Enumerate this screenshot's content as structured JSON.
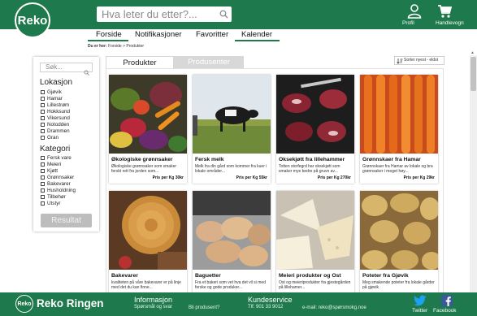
{
  "header": {
    "logo_text": "Reko",
    "search_placeholder": "Hva leter du etter?...",
    "profile_label": "Profil",
    "cart_label": "Handlevogn"
  },
  "nav": {
    "items": [
      "Forside",
      "Notifikasjoner",
      "Favoritter",
      "Kalender"
    ]
  },
  "breadcrumb": {
    "prefix": "Du er her:",
    "path": "Forside > Produkter"
  },
  "sidebar": {
    "search_placeholder": "Søk...",
    "location_heading": "Lokasjon",
    "locations": [
      "Gjøvik",
      "Hamar",
      "Lillestrøm",
      "Hokksund",
      "Vikersund",
      "Notodden",
      "Drammen",
      "Gran"
    ],
    "category_heading": "Kategori",
    "categories": [
      "Fersk vare",
      "Meieri",
      "Kjøtt",
      "Grønnsaker",
      "Bakevarer",
      "Husholdning",
      "Tilbehør",
      "Utstyr"
    ],
    "result_button": "Resultat"
  },
  "tabs": {
    "products": "Produkter",
    "producers": "Produsenter"
  },
  "sort": {
    "label": "Sorter nyest - eldst"
  },
  "products": [
    {
      "title": "Økologiske grønnsaker",
      "desc": "Økologiske grønnsaker som smaker ferskt rett fra jorden som...",
      "price": "Pris per Kg 30kr"
    },
    {
      "title": "Fersk melk",
      "desc": "Melk fra din gård som kommer fra kuer i lokale områder...",
      "price": "Pris per Kg 55kr"
    },
    {
      "title": "Oksekjøtt fra lillehammer",
      "desc": "Totten storfegrd har oksekjøtt som smaker mye bedre på gruvn av...",
      "price": "Pris per Kg 270kr"
    },
    {
      "title": "Grønnskaer fra Hamar",
      "desc": "Grønnskaer fra Hamar av lokale og bra grønnsaker i meget høy...",
      "price": "Pris per Kg 29kr"
    },
    {
      "title": "Bakevarer",
      "desc": "kvaliteten på våre bakevarer er på linje med det du kan finne...",
      "price": ""
    },
    {
      "title": "Baguetter",
      "desc": "Fra et bakeri som vet hva det vil si med ferske og gode produker...",
      "price": ""
    },
    {
      "title": "Meieri produkter og Ost",
      "desc": "Ost og meieriprodukter fra gjestegården på lillehamer...",
      "price": ""
    },
    {
      "title": "Poteter fra Gjøvik",
      "desc": "Meg smakende poteter fra lokale gårder på gjøvik",
      "price": ""
    }
  ],
  "footer": {
    "logo_text": "Reko",
    "brand": "Reko Ringen",
    "info_heading": "Informasjon",
    "info_sub1": "Spørsmål og svar",
    "info_sub2": "Bli produsent?",
    "service_heading": "Kundeservice",
    "service_phone": "Tlf: 901 33 9012",
    "service_email": "e-mail: reko@spørsmokg.noe",
    "twitter": "Twitter",
    "facebook": "Facebook"
  },
  "colors": {
    "brand_green": "#1e7a4c",
    "twitter_blue": "#1da1f2",
    "facebook_blue": "#3b5998"
  }
}
